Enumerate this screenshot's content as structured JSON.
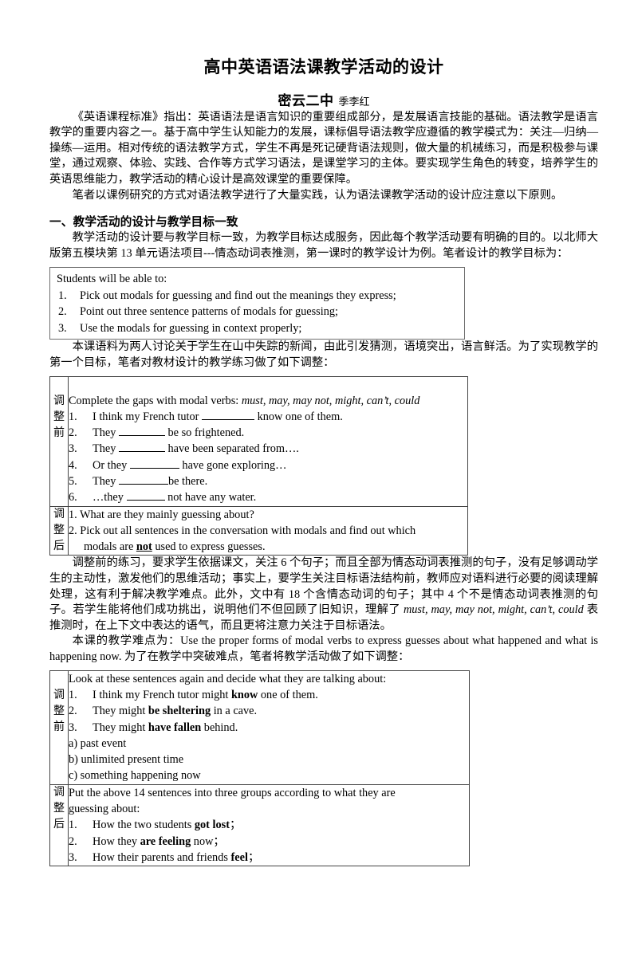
{
  "document": {
    "title": "高中英语语法课教学活动的设计",
    "school": "密云二中",
    "author": "季李红"
  },
  "intro": {
    "paragraph1": "《英语课程标准》指出：英语语法是语言知识的重要组成部分，是发展语言技能的基础。语法教学是语言教学的重要内容之一。基于高中学生认知能力的发展，课标倡导语法教学应遵循的教学模式为：关注—归纳—操练—运用。相对传统的语法教学方式，学生不再是死记硬背语法规则，做大量的机械练习，而是积极参与课堂，通过观察、体验、实践、合作等方式学习语法，是课堂学习的主体。要实现学生角色的转变，培养学生的英语思维能力，教学活动的精心设计是高效课堂的重要保障。",
    "paragraph2": "笔者以课例研究的方式对语法教学进行了大量实践，认为语法课教学活动的设计应注意以下原则。"
  },
  "section1": {
    "heading": "一、教学活动的设计与教学目标一致",
    "paragraph": "教学活动的设计要与教学目标一致，为教学目标达成服务，因此每个教学活动要有明确的目的。以北师大版第五模块第 13 单元语法项目---情态动词表推测，第一课时的教学设计为例。笔者设计的教学目标为："
  },
  "objectives_box": {
    "intro": "Students will be able to:",
    "items": [
      {
        "num": "1.",
        "text": "Pick out modals for guessing and find out the meanings they express;"
      },
      {
        "num": "2.",
        "text": "Point out three sentence patterns of modals for guessing;"
      },
      {
        "num": "3.",
        "text": "Use the modals for guessing in context properly;"
      }
    ]
  },
  "after_objectives_paragraph": "本课语料为两人讨论关于学生在山中失踪的新闻，由此引发猜测，语境突出，语言鲜活。为了实现教学的第一个目标，笔者对教材设计的教学练习做了如下调整：",
  "table1": {
    "before_label": [
      "调",
      "整",
      "前"
    ],
    "after_label": [
      "调",
      "整",
      "后"
    ],
    "before": {
      "prompt_lead": "Complete the gaps with modal verbs: ",
      "prompt_modals": "must, may, may not, might, can’t, could",
      "items": [
        {
          "num": "1.",
          "pre": "I think my French tutor ",
          "post": " know one of them."
        },
        {
          "num": "2.",
          "pre": "They ",
          "post": " be so frightened."
        },
        {
          "num": "3.",
          "pre": "They ",
          "post": " have been separated from…."
        },
        {
          "num": "4.",
          "pre": "Or they ",
          "post": " have gone exploring…"
        },
        {
          "num": "5.",
          "pre": "They ",
          "post": "be there."
        },
        {
          "num": "6.",
          "pre": "…they ",
          "post": " not have any water."
        }
      ]
    },
    "after": {
      "item1": "1. What are they mainly guessing about?",
      "item2_line1": "2. Pick out all sentences in the conversation with modals and find out which",
      "item2_line2_pre": "modals are ",
      "item2_line2_bold": "not",
      "item2_line2_post": " used to express guesses."
    }
  },
  "analysis_paragraph": {
    "part1": "调整前的练习，要求学生依据课文，关注 6 个句子；而且全部为情态动词表推测的句子，没有足够调动学生的主动性，激发他们的思维活动；事实上，要学生关注目标语法结构前，教师应对语料进行必要的阅读理解处理，这有利于解决教学难点。此外，文中有 18 个含情态动词的句子；其中 4 个不是情态动词表推测的句子。若学生能将他们成功挑出，说明他们不但回顾了旧知识，理解了 ",
    "italic": "must, may, may not, might, can’t, could",
    "part2": " 表推测时，在上下文中表达的语气，而且更将注意力关注于目标语法。"
  },
  "difficulty_paragraph": {
    "lead": "本课的教学难点为：",
    "english": "Use the proper forms of modal verbs to express guesses about what happened and what is happening now.",
    "tail": " 为了在教学中突破难点，笔者将教学活动做了如下调整："
  },
  "table2": {
    "before_label": [
      "调",
      "整",
      "前"
    ],
    "after_label": [
      "调",
      "整",
      "后"
    ],
    "before": {
      "intro": "Look at these sentences again and decide what they are talking about:",
      "items": [
        {
          "num": "1.",
          "pre": "I think my French tutor might ",
          "bold": "know",
          "post": " one of them."
        },
        {
          "num": "2.",
          "pre": "They might ",
          "bold": "be sheltering",
          "post": " in a cave."
        },
        {
          "num": "3.",
          "pre": "They might ",
          "bold": "have fallen",
          "post": " behind."
        }
      ],
      "options": [
        "a) past event",
        "b) unlimited present time",
        "c) something happening now"
      ]
    },
    "after": {
      "intro_line1": "Put the above 14 sentences into three groups according to what they are",
      "intro_line2": "guessing about:",
      "items": [
        {
          "num": "1.",
          "pre": "How the two students ",
          "bold": "got lost",
          "post": "；"
        },
        {
          "num": "2.",
          "pre": "How they ",
          "bold": "are feeling",
          "post": " now；"
        },
        {
          "num": "3.",
          "pre": "How their parents and friends ",
          "bold": "feel",
          "post": "；"
        }
      ]
    }
  }
}
